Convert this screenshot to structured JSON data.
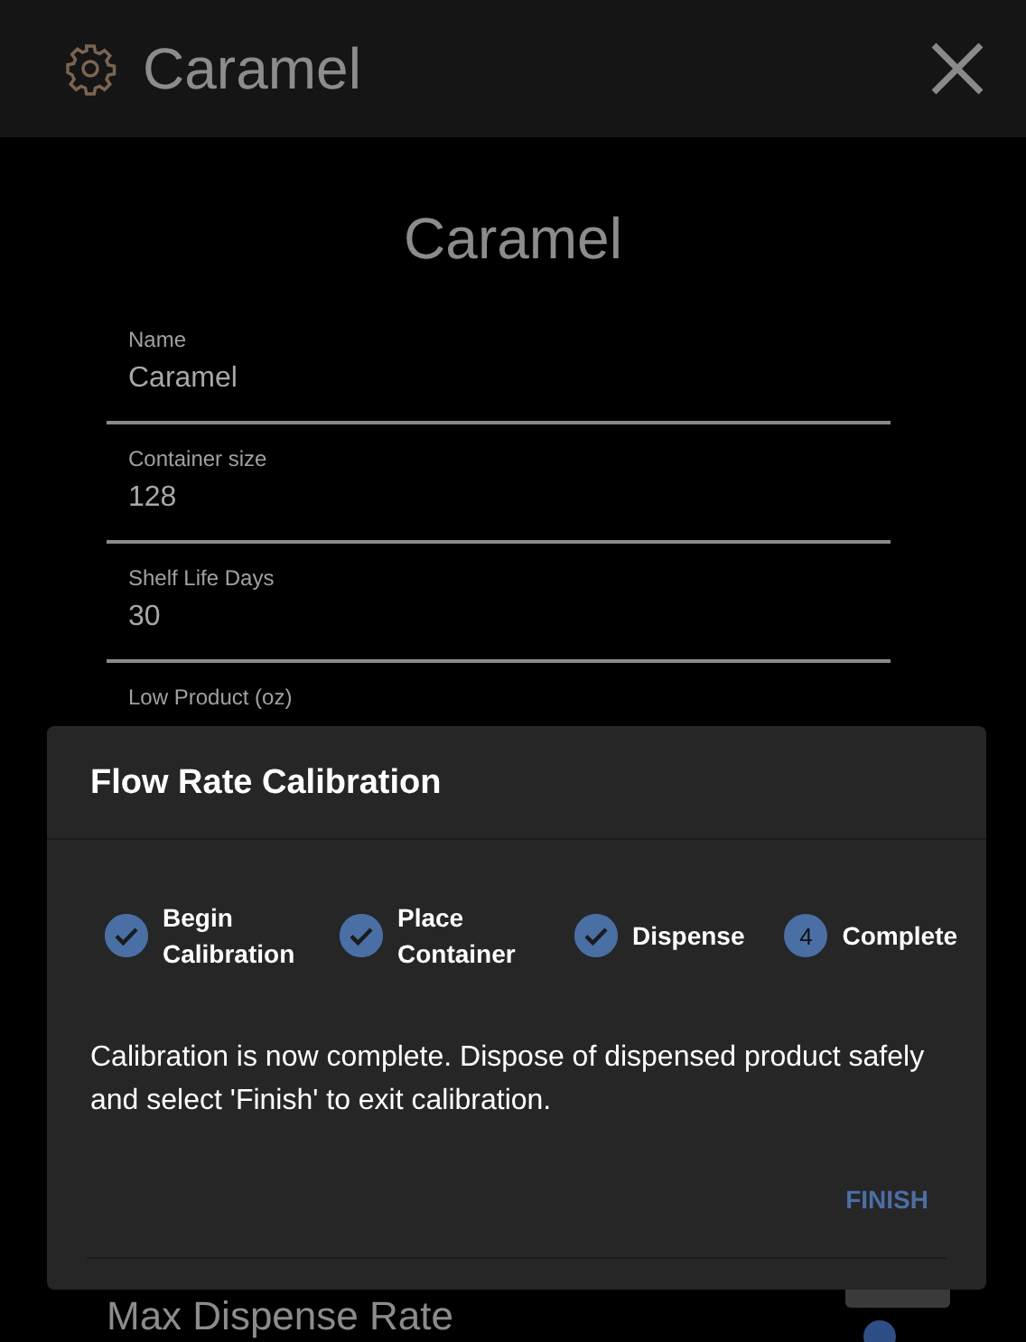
{
  "header": {
    "title": "Caramel"
  },
  "page_title": "Caramel",
  "fields": [
    {
      "label": "Name",
      "value": "Caramel"
    },
    {
      "label": "Container size",
      "value": "128"
    },
    {
      "label": "Shelf Life Days",
      "value": "30"
    },
    {
      "label": "Low Product (oz)"
    }
  ],
  "slider": {
    "label": "Max Dispense Rate"
  },
  "dialog": {
    "title": "Flow Rate Calibration",
    "steps": [
      {
        "label": "Begin Calibration",
        "completed": true
      },
      {
        "label": "Place Container",
        "completed": true
      },
      {
        "label": "Dispense",
        "completed": true
      },
      {
        "label": "Complete",
        "completed": false,
        "number": "4"
      }
    ],
    "message": "Calibration is now complete. Dispose of dispensed product safely and select 'Finish' to exit calibration.",
    "button": "FINISH"
  }
}
